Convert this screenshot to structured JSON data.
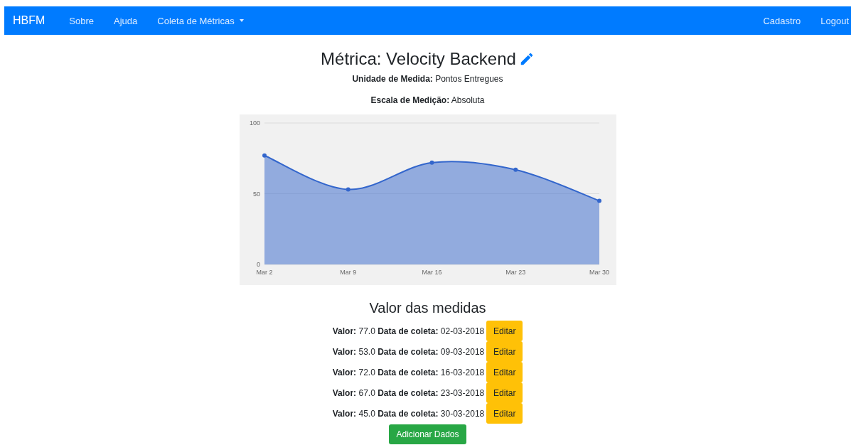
{
  "navbar": {
    "brand": "HBFM",
    "left_items": [
      {
        "label": "Sobre",
        "dropdown": false
      },
      {
        "label": "Ajuda",
        "dropdown": false
      },
      {
        "label": "Coleta de Métricas",
        "dropdown": true
      }
    ],
    "right_items": [
      {
        "label": "Cadastro"
      },
      {
        "label": "Logout"
      }
    ]
  },
  "metric": {
    "title": "Métrica: Velocity Backend",
    "unit": "**Unidade de Medida:** Pontos Entregues",
    "scale": "**Escala de Medição:** Absoluta",
    "chart_data": {
      "type": "area",
      "categories": [
        "Mar 2",
        "Mar 9",
        "Mar 16",
        "Mar 23",
        "Mar 30"
      ],
      "series": [
        {
          "color": "#3366cc",
          "values": [
            77,
            53,
            72,
            67,
            45
          ]
        }
      ],
      "ylim": [
        0,
        100
      ],
      "yticks": [
        0,
        50,
        100
      ]
    }
  },
  "measures": {
    "heading": "Valor das medidas",
    "rows": [
      {
        "text": "**Valor:** 77.0 **Data de coleta:** 02-03-2018",
        "button": "Editar"
      },
      {
        "text": "**Valor:** 53.0 **Data de coleta:** 09-03-2018",
        "button": "Editar"
      },
      {
        "text": "**Valor:** 72.0 **Data de coleta:** 16-03-2018",
        "button": "Editar"
      },
      {
        "text": "**Valor:** 67.0 **Data de coleta:** 23-03-2018",
        "button": "Editar"
      },
      {
        "text": "**Valor:** 45.0 **Data de coleta:** 30-03-2018",
        "button": "Editar"
      }
    ],
    "add_button": "Adicionar Dados"
  }
}
